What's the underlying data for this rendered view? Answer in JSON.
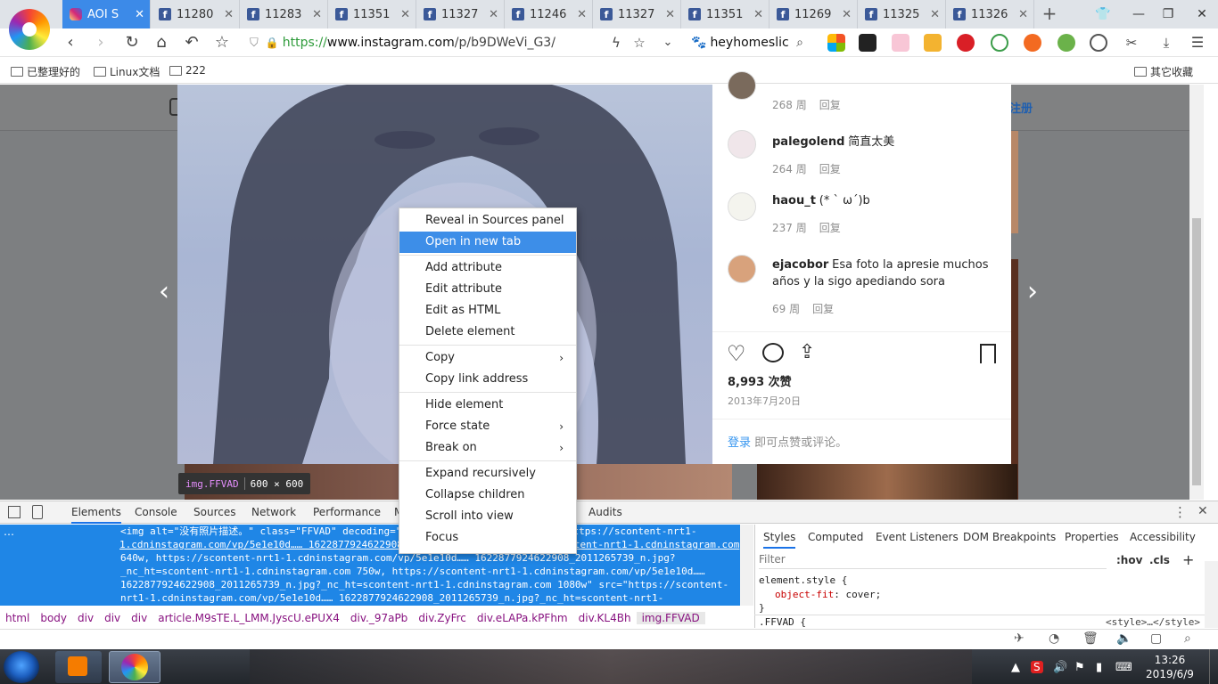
{
  "tabs": [
    {
      "label": "AOI S",
      "active": true
    },
    {
      "label": "11280",
      "active": false
    },
    {
      "label": "11283",
      "active": false
    },
    {
      "label": "11351",
      "active": false
    },
    {
      "label": "11327",
      "active": false
    },
    {
      "label": "11246",
      "active": false
    },
    {
      "label": "11327",
      "active": false
    },
    {
      "label": "11351",
      "active": false
    },
    {
      "label": "11269",
      "active": false
    },
    {
      "label": "11325",
      "active": false
    },
    {
      "label": "11326",
      "active": false
    }
  ],
  "address": {
    "protocol": "https://",
    "host": "www.instagram.com",
    "path": "/p/b9DWeVi_G3/"
  },
  "search": {
    "text": "heyhomeslic"
  },
  "bookmarks": [
    {
      "label": "已整理好的"
    },
    {
      "label": "Linux文档"
    },
    {
      "label": "222"
    }
  ],
  "bookmarks_other": "其它收藏",
  "page": {
    "signup": "注册",
    "comments": [
      {
        "user": "",
        "text": "",
        "age": "268 周",
        "reply": "回复"
      },
      {
        "user": "palegolend",
        "text": "简直太美",
        "age": "264 周",
        "reply": "回复"
      },
      {
        "user": "haou_t",
        "text": "(* ` ω´)b",
        "age": "237 周",
        "reply": "回复"
      },
      {
        "user": "ejacobor",
        "text": "Esa foto la apresie muchos años y la sigo apediando sora",
        "age": "69 周",
        "reply": "回复"
      }
    ],
    "likes": "8,993 次赞",
    "date": "2013年7月20日",
    "login_link": "登录",
    "login_text": "即可点赞或评论。"
  },
  "hover_badge": {
    "tag": "img.FFVAD",
    "size": "600 × 600"
  },
  "context_menu": {
    "groups": [
      [
        {
          "label": "Reveal in Sources panel",
          "highlighted": false
        },
        {
          "label": "Open in new tab",
          "highlighted": true
        }
      ],
      [
        {
          "label": "Add attribute"
        },
        {
          "label": "Edit attribute"
        },
        {
          "label": "Edit as HTML"
        },
        {
          "label": "Delete element"
        }
      ],
      [
        {
          "label": "Copy",
          "submenu": true
        },
        {
          "label": "Copy link address"
        }
      ],
      [
        {
          "label": "Hide element"
        },
        {
          "label": "Force state",
          "submenu": true
        },
        {
          "label": "Break on",
          "submenu": true
        }
      ],
      [
        {
          "label": "Expand recursively"
        },
        {
          "label": "Collapse children"
        },
        {
          "label": "Scroll into view"
        },
        {
          "label": "Focus"
        }
      ]
    ]
  },
  "devtools": {
    "tabs": [
      "Elements",
      "Console",
      "Sources",
      "Network",
      "Performance",
      "M",
      "Audits"
    ],
    "code_lines": [
      "<img alt=\"没有照片描述。\" class=\"FFVAD\" decoding=\"auto\" sizes=\"600px\" srcset=\"https://scontent-nrt1-",
      "1.cdninstagram.com/vp/5e1e10d…… 1622877924622908_2011265739_n.jpg? nc ht=scontent-nrt1-1.cdninstagram.com",
      "640w, https://scontent-nrt1-1.cdninstagram.com/vp/5e1e10d…… 1622877924622908_2011265739_n.jpg?",
      "_nc_ht=scontent-nrt1-1.cdninstagram.com 750w, https://scontent-nrt1-1.cdninstagram.com/vp/5e1e10d……",
      "1622877924622908_2011265739_n.jpg?_nc_ht=scontent-nrt1-1.cdninstagram.com 1080w\" src=\"https://scontent-",
      "nrt1-1.cdninstagram.com/vp/5e1e10d…… 1622877924622908_2011265739_n.jpg?_nc_ht=scontent-nrt1-"
    ],
    "breadcrumbs": [
      "html",
      "body",
      "div",
      "div",
      "div",
      "article.M9sTE.L_LMM.JyscU.ePUX4",
      "div._97aPb",
      "div.ZyFrc",
      "div.eLAPa.kPFhm",
      "div.KL4Bh",
      "img.FFVAD"
    ],
    "style_tabs": [
      "Styles",
      "Computed",
      "Event Listeners",
      "DOM Breakpoints",
      "Properties",
      "Accessibility"
    ],
    "filter_placeholder": "Filter",
    "hov": ":hov",
    "cls": ".cls",
    "rule_selector": "element.style {",
    "rule_prop": "object-fit",
    "rule_value": "cover;",
    "rule_close": "}",
    "next_rule": ".FFVAD {",
    "next_rule_source": "<style>…</style>"
  },
  "taskbar": {
    "time": "13:26",
    "date": "2019/6/9"
  },
  "colors": {
    "accent": "#3d8ee8",
    "devtools_selection": "#1f86e6",
    "tab_active": "#3c8ae8"
  }
}
